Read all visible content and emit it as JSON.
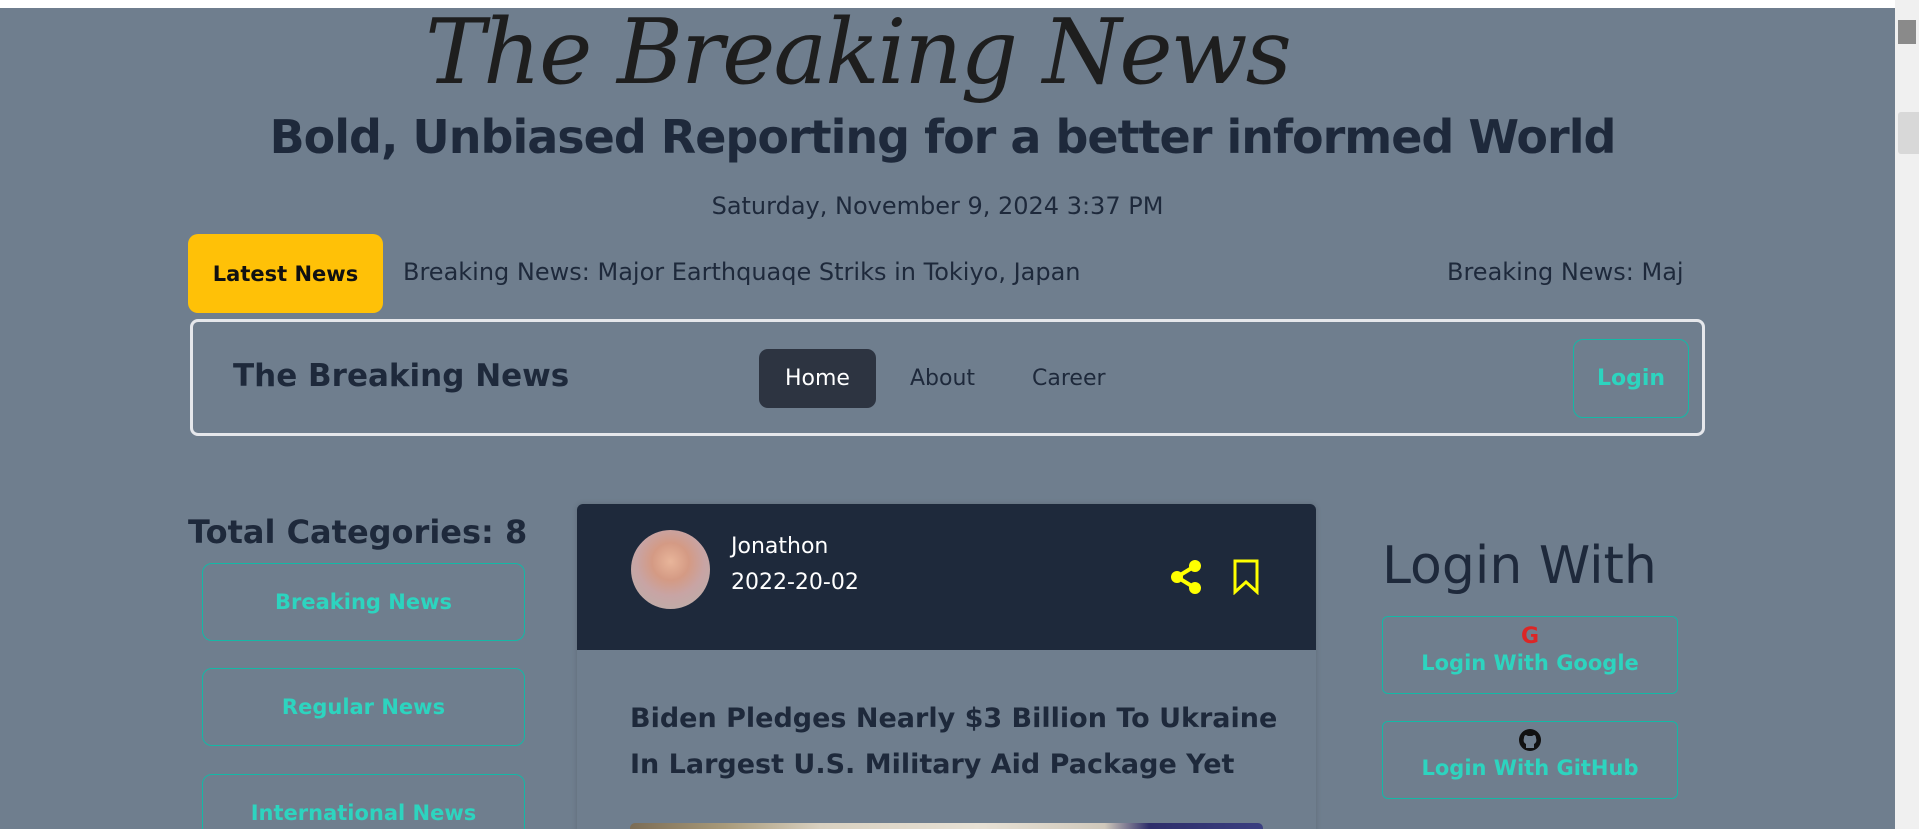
{
  "header": {
    "script_title": "The Breaking News",
    "headline": "Bold, Unbiased Reporting for a better informed World",
    "date": "Saturday, November 9, 2024 3:37 PM"
  },
  "ticker": {
    "label": "Latest News",
    "items": [
      "Breaking News: Major Earthquaqe Striks in Tokiyo, Japan",
      "Breaking News: Maj"
    ],
    "visible_first": "or Earthquaqe Striks in Tokiyo, Japan"
  },
  "nav": {
    "brand": "The Breaking News",
    "links": [
      "Home",
      "About",
      "Career"
    ],
    "active": "Home",
    "login": "Login"
  },
  "categories": {
    "title": "Total Categories: 8",
    "items": [
      "Breaking News",
      "Regular News",
      "International News"
    ]
  },
  "card": {
    "author": "Jonathon",
    "date": "2022-20-02",
    "title": "Biden Pledges Nearly $3 Billion To Ukraine In Largest U.S. Military Aid Package Yet",
    "icons": [
      "share-icon",
      "bookmark-icon"
    ],
    "icon_color": "#ffff00"
  },
  "login_with": {
    "title": "Login With",
    "google": "Login With Google",
    "github": "Login With GitHub"
  },
  "colors": {
    "background": "#6f7e8e",
    "accent": "#2dd4bf",
    "badge": "#ffc107",
    "dark": "#1e293b"
  }
}
